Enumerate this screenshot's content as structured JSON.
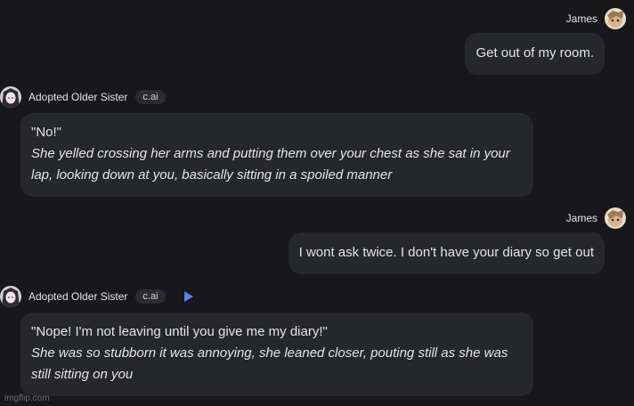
{
  "messages": [
    {
      "type": "user",
      "name": "James",
      "text": "Get out of my room."
    },
    {
      "type": "bot",
      "name": "Adopted Older Sister",
      "badge": "c.ai",
      "quote": "\"No!\"",
      "action": "She yelled crossing her arms and putting them over your chest as she sat in your lap, looking down at you, basically sitting in a spoiled manner"
    },
    {
      "type": "user",
      "name": "James",
      "text": "I wont ask twice. I don't have your diary so get out"
    },
    {
      "type": "bot",
      "name": "Adopted Older Sister",
      "badge": "c.ai",
      "quote": "\"Nope! I'm not leaving until you give me my diary!\"",
      "action": "She was so stubborn it was annoying, she leaned closer, pouting still as she was still sitting on you"
    }
  ],
  "icons": {
    "play": "play-icon"
  },
  "colors": {
    "accent": "#5b7cf7",
    "bubble": "#26272b",
    "background": "#18181b"
  },
  "watermark": "imgflip.com"
}
